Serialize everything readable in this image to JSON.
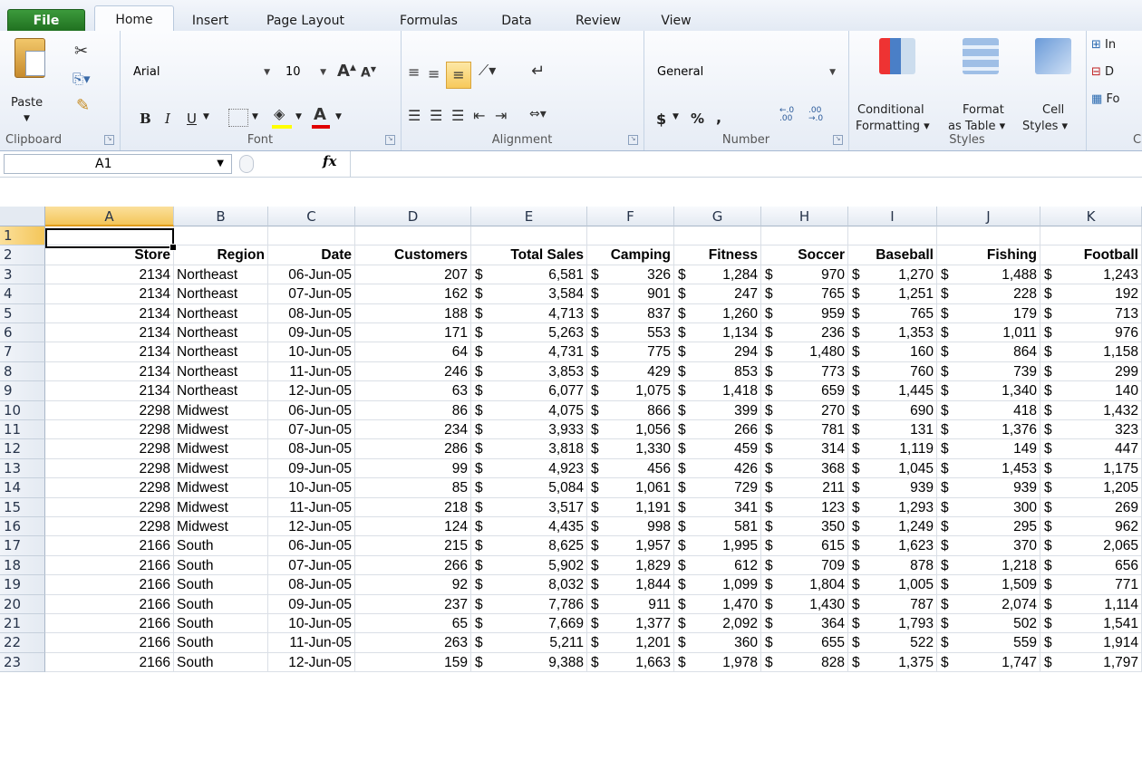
{
  "tabs": [
    "File",
    "Home",
    "Insert",
    "Page Layout",
    "Formulas",
    "Data",
    "Review",
    "View"
  ],
  "clipboard": {
    "paste": "Paste",
    "label": "Clipboard"
  },
  "font": {
    "name": "Arial",
    "size": "10",
    "label": "Font",
    "bold": "B",
    "italic": "I",
    "underline": "U"
  },
  "alignment": {
    "label": "Alignment"
  },
  "number": {
    "format": "General",
    "label": "Number",
    "currency": "$",
    "percent": "%",
    "comma": ",",
    "inc": "←.0 .00",
    "dec": ".00 →.0"
  },
  "styles": {
    "label": "Styles",
    "conditional": "Conditional",
    "conditional2": "Formatting ▾",
    "format": "Format",
    "format2": "as Table ▾",
    "cell": "Cell",
    "cell2": "Styles ▾"
  },
  "cells": {
    "label": "C",
    "insert": "In",
    "delete": "D",
    "format": "Fo"
  },
  "formula_bar": {
    "name_box": "A1",
    "fx": "fx",
    "formula": ""
  },
  "columns": [
    "A",
    "B",
    "C",
    "D",
    "E",
    "F",
    "G",
    "H",
    "I",
    "J",
    "K"
  ],
  "selected_column": "A",
  "rows": [
    [
      "1",
      "",
      "",
      "",
      "",
      "",
      "",
      "",
      "",
      "",
      "",
      ""
    ],
    [
      "2",
      "Store",
      "Region",
      "Date",
      "Customers",
      "Total Sales",
      "Camping",
      "Fitness",
      "Soccer",
      "Baseball",
      "Fishing",
      "Football"
    ],
    [
      "3",
      "2134",
      "Northeast",
      "06-Jun-05",
      "207",
      "6,581",
      "326",
      "1,284",
      "970",
      "1,270",
      "1,488",
      "1,243"
    ],
    [
      "4",
      "2134",
      "Northeast",
      "07-Jun-05",
      "162",
      "3,584",
      "901",
      "247",
      "765",
      "1,251",
      "228",
      "192"
    ],
    [
      "5",
      "2134",
      "Northeast",
      "08-Jun-05",
      "188",
      "4,713",
      "837",
      "1,260",
      "959",
      "765",
      "179",
      "713"
    ],
    [
      "6",
      "2134",
      "Northeast",
      "09-Jun-05",
      "171",
      "5,263",
      "553",
      "1,134",
      "236",
      "1,353",
      "1,011",
      "976"
    ],
    [
      "7",
      "2134",
      "Northeast",
      "10-Jun-05",
      "64",
      "4,731",
      "775",
      "294",
      "1,480",
      "160",
      "864",
      "1,158"
    ],
    [
      "8",
      "2134",
      "Northeast",
      "11-Jun-05",
      "246",
      "3,853",
      "429",
      "853",
      "773",
      "760",
      "739",
      "299"
    ],
    [
      "9",
      "2134",
      "Northeast",
      "12-Jun-05",
      "63",
      "6,077",
      "1,075",
      "1,418",
      "659",
      "1,445",
      "1,340",
      "140"
    ],
    [
      "10",
      "2298",
      "Midwest",
      "06-Jun-05",
      "86",
      "4,075",
      "866",
      "399",
      "270",
      "690",
      "418",
      "1,432"
    ],
    [
      "11",
      "2298",
      "Midwest",
      "07-Jun-05",
      "234",
      "3,933",
      "1,056",
      "266",
      "781",
      "131",
      "1,376",
      "323"
    ],
    [
      "12",
      "2298",
      "Midwest",
      "08-Jun-05",
      "286",
      "3,818",
      "1,330",
      "459",
      "314",
      "1,119",
      "149",
      "447"
    ],
    [
      "13",
      "2298",
      "Midwest",
      "09-Jun-05",
      "99",
      "4,923",
      "456",
      "426",
      "368",
      "1,045",
      "1,453",
      "1,175"
    ],
    [
      "14",
      "2298",
      "Midwest",
      "10-Jun-05",
      "85",
      "5,084",
      "1,061",
      "729",
      "211",
      "939",
      "939",
      "1,205"
    ],
    [
      "15",
      "2298",
      "Midwest",
      "11-Jun-05",
      "218",
      "3,517",
      "1,191",
      "341",
      "123",
      "1,293",
      "300",
      "269"
    ],
    [
      "16",
      "2298",
      "Midwest",
      "12-Jun-05",
      "124",
      "4,435",
      "998",
      "581",
      "350",
      "1,249",
      "295",
      "962"
    ],
    [
      "17",
      "2166",
      "South",
      "06-Jun-05",
      "215",
      "8,625",
      "1,957",
      "1,995",
      "615",
      "1,623",
      "370",
      "2,065"
    ],
    [
      "18",
      "2166",
      "South",
      "07-Jun-05",
      "266",
      "5,902",
      "1,829",
      "612",
      "709",
      "878",
      "1,218",
      "656"
    ],
    [
      "19",
      "2166",
      "South",
      "08-Jun-05",
      "92",
      "8,032",
      "1,844",
      "1,099",
      "1,804",
      "1,005",
      "1,509",
      "771"
    ],
    [
      "20",
      "2166",
      "South",
      "09-Jun-05",
      "237",
      "7,786",
      "911",
      "1,470",
      "1,430",
      "787",
      "2,074",
      "1,114"
    ],
    [
      "21",
      "2166",
      "South",
      "10-Jun-05",
      "65",
      "7,669",
      "1,377",
      "2,092",
      "364",
      "1,793",
      "502",
      "1,541"
    ],
    [
      "22",
      "2166",
      "South",
      "11-Jun-05",
      "263",
      "5,211",
      "1,201",
      "360",
      "655",
      "522",
      "559",
      "1,914"
    ],
    [
      "23",
      "2166",
      "South",
      "12-Jun-05",
      "159",
      "9,388",
      "1,663",
      "1,978",
      "828",
      "1,375",
      "1,747",
      "1,797"
    ]
  ],
  "currency_symbol": "$",
  "accent": "#f4c659",
  "file_tab_color": "#2e8b2e"
}
